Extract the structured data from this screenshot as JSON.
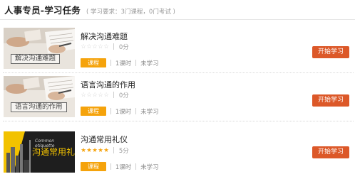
{
  "header": {
    "title": "人事专员-学习任务",
    "meta": "( 学习要求：3门课程，0门考试 )"
  },
  "courses": [
    {
      "title": "解决沟通难题",
      "thumb_label": "解决沟通难题",
      "thumb_theme": "light",
      "stars_filled": 0,
      "score": "0分",
      "tag": "课程",
      "hours": "1课时",
      "status": "未学习",
      "button": "开始学习"
    },
    {
      "title": "语言沟通的作用",
      "thumb_label": "语言沟通的作用",
      "thumb_theme": "light",
      "stars_filled": 0,
      "score": "0分",
      "tag": "课程",
      "hours": "1课时",
      "status": "未学习",
      "button": "开始学习"
    },
    {
      "title": "沟通常用礼仪",
      "thumb_label": "沟通常用礼仪",
      "thumb_caption": "Common etiquette",
      "thumb_theme": "dark",
      "stars_filled": 5,
      "score": "5分",
      "tag": "课程",
      "hours": "1课时",
      "status": "未学习",
      "button": "开始学习"
    }
  ],
  "colors": {
    "tag": "#f5a30c",
    "button": "#dc5828",
    "star_on": "#f5a30c",
    "star_off": "#cfcfcf"
  }
}
